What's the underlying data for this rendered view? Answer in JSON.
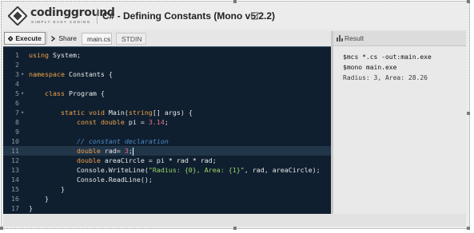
{
  "header": {
    "logo_text": "codingground",
    "logo_tagline": "SIMPLY EASY CODING",
    "title": "C# - Defining Constants (Mono v5.2.2)"
  },
  "toolbar": {
    "execute_label": "Execute",
    "share_label": "Share",
    "tabs": [
      {
        "label": "main.cs",
        "active": true
      },
      {
        "label": "STDIN",
        "active": false
      }
    ]
  },
  "editor": {
    "current_line": 11,
    "lines": [
      {
        "num": "1",
        "fold": false,
        "tokens": [
          [
            "kw",
            "using"
          ],
          [
            "p",
            " System;"
          ]
        ]
      },
      {
        "num": "2",
        "fold": false,
        "tokens": []
      },
      {
        "num": "3",
        "fold": true,
        "tokens": [
          [
            "kw",
            "namespace"
          ],
          [
            "p",
            " Constants {"
          ]
        ]
      },
      {
        "num": "4",
        "fold": false,
        "tokens": []
      },
      {
        "num": "5",
        "fold": true,
        "tokens": [
          [
            "p",
            "    "
          ],
          [
            "kw",
            "class"
          ],
          [
            "p",
            " Program {"
          ]
        ]
      },
      {
        "num": "6",
        "fold": false,
        "tokens": []
      },
      {
        "num": "7",
        "fold": true,
        "tokens": [
          [
            "p",
            "        "
          ],
          [
            "kw",
            "static"
          ],
          [
            "p",
            " "
          ],
          [
            "kw",
            "void"
          ],
          [
            "p",
            " Main("
          ],
          [
            "kw",
            "string"
          ],
          [
            "p",
            "[] args) {"
          ]
        ]
      },
      {
        "num": "8",
        "fold": false,
        "tokens": [
          [
            "p",
            "            "
          ],
          [
            "kw",
            "const"
          ],
          [
            "p",
            " "
          ],
          [
            "kw",
            "double"
          ],
          [
            "p",
            " pi = "
          ],
          [
            "num",
            "3.14"
          ],
          [
            "p",
            ";"
          ]
        ]
      },
      {
        "num": "9",
        "fold": false,
        "tokens": []
      },
      {
        "num": "10",
        "fold": false,
        "tokens": [
          [
            "p",
            "            "
          ],
          [
            "cmt",
            "// constant declaration"
          ]
        ]
      },
      {
        "num": "11",
        "fold": false,
        "tokens": [
          [
            "p",
            "            "
          ],
          [
            "kw",
            "double"
          ],
          [
            "p",
            " rad= "
          ],
          [
            "num",
            "3"
          ],
          [
            "p",
            ";"
          ],
          [
            "caret",
            ""
          ]
        ]
      },
      {
        "num": "12",
        "fold": false,
        "tokens": [
          [
            "p",
            "            "
          ],
          [
            "kw",
            "double"
          ],
          [
            "p",
            " areaCircle = pi * rad * rad;"
          ]
        ]
      },
      {
        "num": "13",
        "fold": false,
        "tokens": [
          [
            "p",
            "            Console.WriteLine("
          ],
          [
            "str",
            "\"Radius: {0}, Area: {1}\""
          ],
          [
            "p",
            ", rad, areaCircle);"
          ]
        ]
      },
      {
        "num": "14",
        "fold": false,
        "tokens": [
          [
            "p",
            "            Console.ReadLine();"
          ]
        ]
      },
      {
        "num": "15",
        "fold": false,
        "tokens": [
          [
            "p",
            "        }"
          ]
        ]
      },
      {
        "num": "16",
        "fold": false,
        "tokens": [
          [
            "p",
            "    }"
          ]
        ]
      },
      {
        "num": "17",
        "fold": false,
        "tokens": [
          [
            "p",
            "}"
          ]
        ]
      }
    ]
  },
  "result": {
    "title": "Result",
    "lines": [
      {
        "text": "$mcs *.cs -out:main.exe",
        "style": "cmd"
      },
      {
        "text": "$mono main.exe",
        "style": "cmd"
      },
      {
        "text": "Radius: 3, Area: 28.26",
        "style": "plain"
      }
    ]
  },
  "colors": {
    "editor_bg": "#0f1f2f",
    "keyword": "#f0a04a",
    "number": "#e8708a",
    "string": "#9ad26b",
    "comment": "#4f88c6"
  }
}
